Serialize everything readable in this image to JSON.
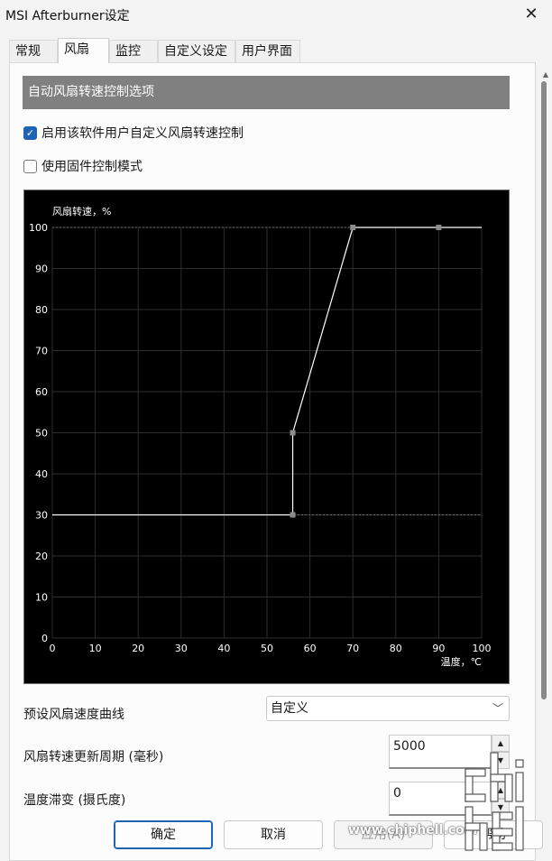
{
  "window": {
    "title": "MSI Afterburner设定",
    "close_glyph": "✕"
  },
  "tabs": [
    {
      "label": "常规"
    },
    {
      "label": "风扇"
    },
    {
      "label": "监控"
    },
    {
      "label": "自定义设定"
    },
    {
      "label": "用户界面"
    }
  ],
  "active_tab": "风扇",
  "fan": {
    "section_title": "自动风扇转速控制选项",
    "enable_custom_label": "启用该软件用户自定义风扇转速控制",
    "enable_custom_checked": true,
    "firmware_mode_label": "使用固件控制模式",
    "firmware_mode_checked": false,
    "preset_label": "预设风扇速度曲线",
    "preset_value": "自定义",
    "update_period_label": "风扇转速更新周期 (毫秒)",
    "update_period_value": "5000",
    "hysteresis_label": "温度滞变 (摄氏度)",
    "hysteresis_value": "0"
  },
  "buttons": {
    "ok": "确定",
    "cancel": "取消",
    "apply": "应用(A)",
    "help": "帮助"
  },
  "watermark": {
    "text": "www.chiphell.com",
    "logo_text": "chip hell"
  },
  "colors": {
    "accent": "#1e64b4",
    "header_bg": "#808080",
    "chart_bg": "#000000",
    "curve": "#ffffff",
    "grid": "#2e2e2e",
    "point": "#8c8c8c"
  },
  "chart_data": {
    "type": "line",
    "ylabel": "风扇转速，%",
    "xlabel": "温度，℃",
    "xlim": [
      0,
      100
    ],
    "ylim": [
      0,
      100
    ],
    "x_ticks": [
      0,
      10,
      20,
      30,
      40,
      50,
      60,
      70,
      80,
      90,
      100
    ],
    "y_ticks": [
      0,
      10,
      20,
      30,
      40,
      50,
      60,
      70,
      80,
      90,
      100
    ],
    "grid": true,
    "series": [
      {
        "points": [
          {
            "x": 0,
            "y": 30
          },
          {
            "x": 56,
            "y": 30
          },
          {
            "x": 56,
            "y": 50
          },
          {
            "x": 70,
            "y": 100
          },
          {
            "x": 100,
            "y": 100
          }
        ]
      }
    ],
    "control_points": [
      {
        "x": 56,
        "y": 30
      },
      {
        "x": 56,
        "y": 50
      },
      {
        "x": 70,
        "y": 100
      },
      {
        "x": 90,
        "y": 100
      }
    ],
    "guide_lines": [
      30,
      100
    ]
  }
}
